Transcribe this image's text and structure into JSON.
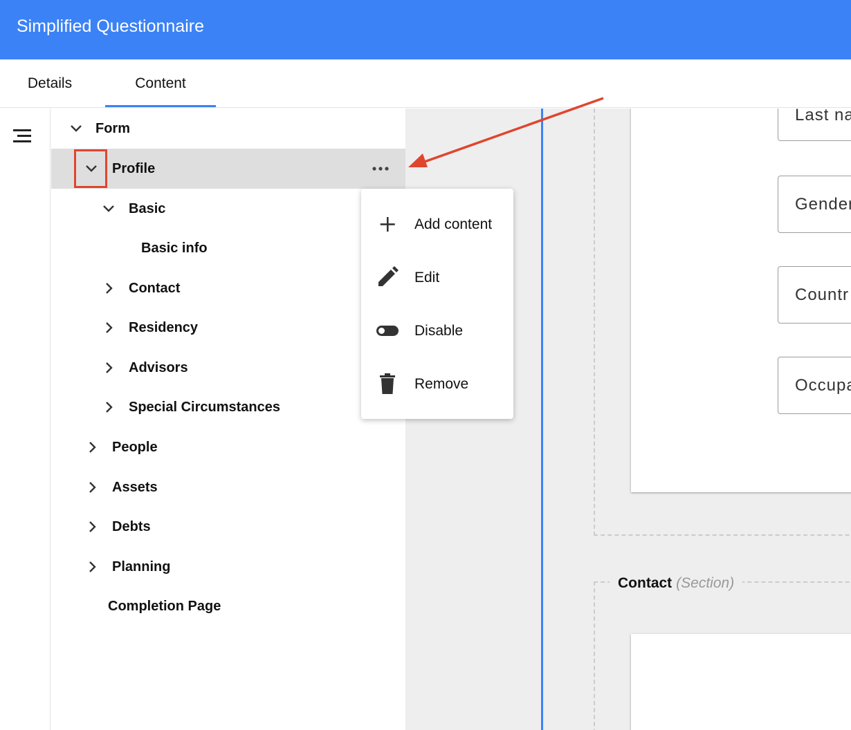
{
  "app": {
    "title": "Simplified Questionnaire",
    "brand_color": "#3b82f6"
  },
  "tabs": [
    {
      "label": "Details",
      "active": false
    },
    {
      "label": "Content",
      "active": true
    }
  ],
  "rail": {
    "icon": "menu-icon"
  },
  "tree": {
    "items": [
      {
        "label": "Form",
        "level": 0,
        "expanded": true
      },
      {
        "label": "Profile",
        "level": 1,
        "expanded": true,
        "selected": true
      },
      {
        "label": "Basic",
        "level": 2,
        "expanded": true
      },
      {
        "label": "Basic info",
        "level": 3
      },
      {
        "label": "Contact",
        "level": 2,
        "expanded": false
      },
      {
        "label": "Residency",
        "level": 2,
        "expanded": false
      },
      {
        "label": "Advisors",
        "level": 2,
        "expanded": false
      },
      {
        "label": "Special Circumstances",
        "level": 2,
        "expanded": false
      },
      {
        "label": "People",
        "level": 1,
        "expanded": false
      },
      {
        "label": "Assets",
        "level": 1,
        "expanded": false
      },
      {
        "label": "Debts",
        "level": 1,
        "expanded": false
      },
      {
        "label": "Planning",
        "level": 1,
        "expanded": false
      },
      {
        "label": "Completion Page",
        "level": 1
      }
    ]
  },
  "context_menu": {
    "items": [
      {
        "label": "Add content",
        "icon": "plus-icon"
      },
      {
        "label": "Edit",
        "icon": "pencil-icon"
      },
      {
        "label": "Disable",
        "icon": "toggle-icon"
      },
      {
        "label": "Remove",
        "icon": "trash-icon"
      }
    ]
  },
  "canvas": {
    "fields": [
      "Last na",
      "Gender",
      "Countr",
      "Occupa"
    ],
    "section": {
      "name": "Contact",
      "type": "(Section)"
    }
  },
  "annotation": {
    "color": "#e0452e"
  }
}
